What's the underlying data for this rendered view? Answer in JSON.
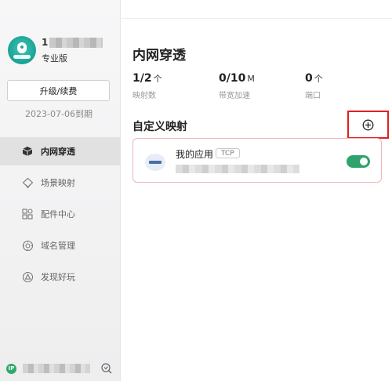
{
  "sidebar": {
    "user": {
      "name_visible": "1",
      "plan": "专业版"
    },
    "upgrade_label": "升级/续费",
    "expire_text": "2023-07-06到期",
    "nav": [
      {
        "label": "内网穿透",
        "icon": "cube-icon",
        "active": true
      },
      {
        "label": "场景映射",
        "icon": "diamond-house-icon",
        "active": false
      },
      {
        "label": "配件中心",
        "icon": "grid-apps-icon",
        "active": false
      },
      {
        "label": "域名管理",
        "icon": "globe-gear-icon",
        "active": false
      },
      {
        "label": "发现好玩",
        "icon": "triangle-circle-icon",
        "active": false
      }
    ],
    "footer": {
      "badge": "IP",
      "icon": "refresh-search-icon"
    }
  },
  "main": {
    "title": "内网穿透",
    "stats": [
      {
        "value": "1/2",
        "unit": "个",
        "label": "映射数"
      },
      {
        "value": "0/10",
        "unit": "M",
        "label": "带宽加速"
      },
      {
        "value": "0",
        "unit": "个",
        "label": "端口"
      }
    ],
    "section_title": "自定义映射",
    "add_icon": "plus-circle-icon",
    "mappings": [
      {
        "name": "我的应用",
        "protocol": "TCP",
        "enabled": true
      }
    ]
  },
  "colors": {
    "accent_green": "#2ea36b",
    "card_border": "#f0b5b8",
    "highlight_red": "#e02020",
    "avatar_teal": "#1fa79a"
  }
}
